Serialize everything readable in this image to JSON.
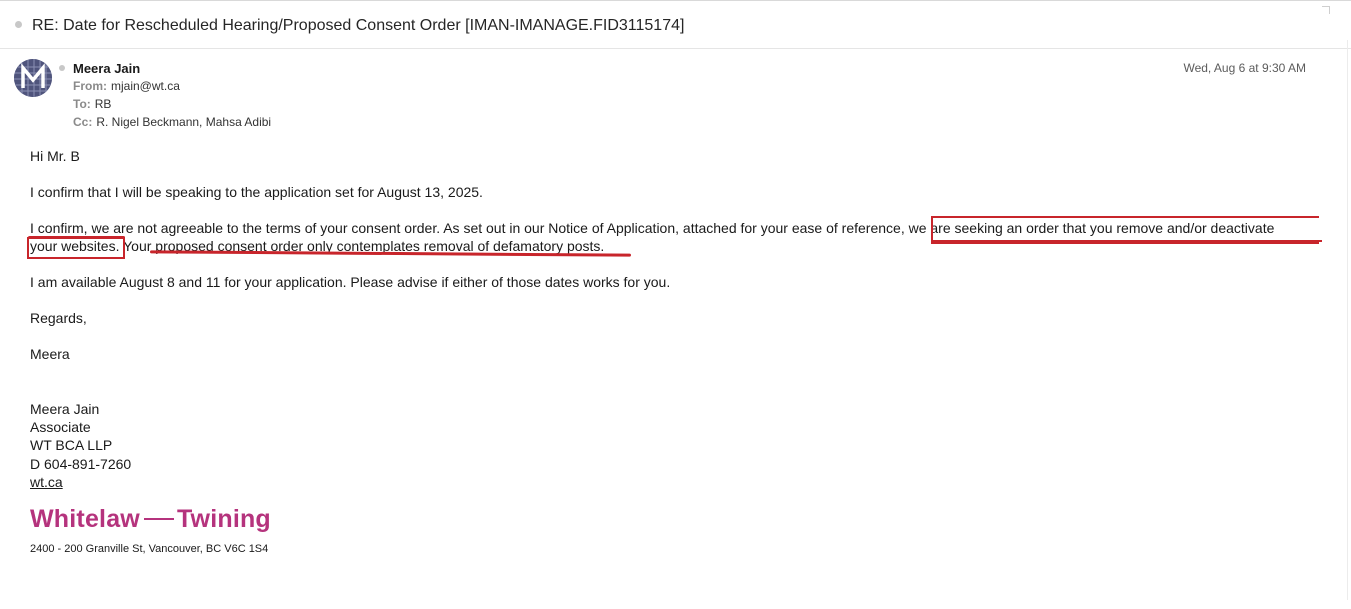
{
  "email": {
    "subject": "RE: Date for Rescheduled Hearing/Proposed Consent Order [IMAN-IMANAGE.FID3115174]",
    "sender_name": "Meera Jain",
    "from_label": "From:",
    "from_value": "mjain@wt.ca",
    "to_label": "To:",
    "to_value": "RB",
    "cc_label": "Cc:",
    "cc_value": "R. Nigel Beckmann,  Mahsa Adibi",
    "date": "Wed, Aug 6 at 9:30 AM",
    "avatar_icon": "monogram-m-avatar"
  },
  "body": {
    "greeting": "Hi Mr. B",
    "p1": "I confirm that I will be speaking to the application set for August 13, 2025.",
    "p2_line1": "I confirm, we are not agreeable to the terms of your consent order. As set out in our Notice of Application, attached for your ease of reference, we are seeking an order that you remove and/or deactivate",
    "p2_line2": "your websites. Your proposed consent order only contemplates removal of defamatory posts.",
    "p3": "I am available August 8 and 11 for your application. Please advise if either of those dates works for you.",
    "closing": "Regards,",
    "sign_name": "Meera"
  },
  "signature": {
    "name": "Meera Jain",
    "title": "Associate",
    "firm": "WT BCA LLP",
    "phone": "D 604-891-7260",
    "website": "wt.ca",
    "logo_left": "Whitelaw",
    "logo_right": "Twining",
    "address": "2400 - 200 Granville St, Vancouver, BC V6C 1S4"
  },
  "colors": {
    "annotation_red": "#c8252b",
    "brand_magenta": "#b5337d"
  }
}
